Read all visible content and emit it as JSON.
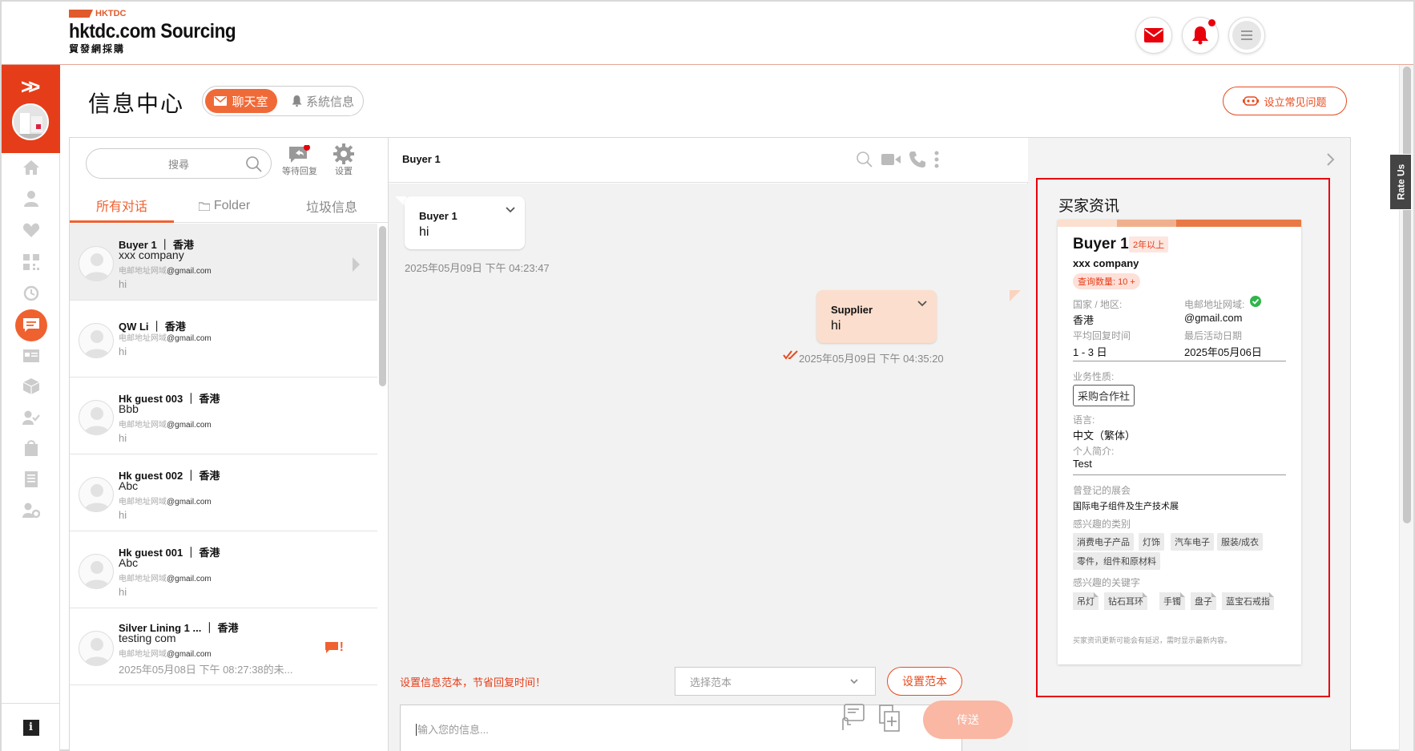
{
  "header": {
    "logo_top": "HKTDC",
    "logo_main": "hktdc.com Sourcing",
    "logo_sub": "貿發網採購"
  },
  "page": {
    "title": "信息中心",
    "tab_chat": "聊天室",
    "tab_system": "系統信息",
    "faq_button": "设立常见问题"
  },
  "list": {
    "search_placeholder": "搜尋",
    "tool_waiting": "等待回复",
    "tool_settings": "设置",
    "tab_all": "所有对话",
    "tab_folder": "Folder",
    "tab_trash": "垃圾信息",
    "email_label": "电邮地址网域",
    "conversations": [
      {
        "name": "Buyer 1 ｜ 香港",
        "company": "xxx company",
        "email": "@gmail.com",
        "message": "hi"
      },
      {
        "name": "QW Li ｜ 香港",
        "company": "",
        "email": "@gmail.com",
        "message": "hi"
      },
      {
        "name": "Hk guest 003 ｜ 香港",
        "company": "Bbb",
        "email": "@gmail.com",
        "message": "hi"
      },
      {
        "name": "Hk guest 002 ｜ 香港",
        "company": "Abc",
        "email": "@gmail.com",
        "message": "hi"
      },
      {
        "name": "Hk guest 001 ｜ 香港",
        "company": "Abc",
        "email": "@gmail.com",
        "message": "hi"
      },
      {
        "name": "Silver Lining 1 ... ｜ 香港",
        "company": "testing com",
        "email": "@gmail.com",
        "message": "2025年05月08日 下午 08:27:38的未..."
      }
    ]
  },
  "chat": {
    "title": "Buyer 1",
    "buyer_name": "Buyer 1",
    "buyer_message": "hi",
    "buyer_time": "2025年05月09日 下午 04:23:47",
    "supplier_name": "Supplier",
    "supplier_message": "hi",
    "supplier_time": "2025年05月09日 下午 04:35:20",
    "template_hint": "设置信息范本，节省回复时间！",
    "template_select": "选择范本",
    "template_button": "设置范本",
    "input_placeholder": "输入您的信息...",
    "send_button": "传送"
  },
  "buyer_info": {
    "section_title": "买家资讯",
    "name": "Buyer 1",
    "years": "2年以上",
    "company": "xxx company",
    "inquiries": "查询数量: 10 +",
    "country_label": "国家 / 地区:",
    "country": "香港",
    "email_label": "电邮地址网域:",
    "email": "@gmail.com",
    "reply_label": "平均回复时间",
    "reply": "1 - 3 日",
    "last_active_label": "最后活动日期",
    "last_active": "2025年05月06日",
    "business_label": "业务性质:",
    "business": "采购合作社",
    "language_label": "语言:",
    "language": "中文（繁体）",
    "profile_label": "个人简介:",
    "profile": "Test",
    "fairs_label": "曾登记的展会",
    "fairs": "国际电子组件及生产技术展",
    "categories_label": "感兴趣的类别",
    "categories": [
      "消费电子产品",
      "灯饰",
      "汽车电子",
      "服装/成衣",
      "零件，组件和原材料"
    ],
    "keywords_label": "感兴趣的关键字",
    "keywords": [
      "吊灯",
      "钻石耳环",
      "手镯",
      "盘子",
      "蓝宝石戒指"
    ],
    "note": "买家资讯更新可能会有延迟，需时显示最新内容。"
  },
  "rate_us": "Rate Us",
  "colors": {
    "accent": "#f06130",
    "brand_red": "#e53d19",
    "alert": "#e8000b"
  }
}
